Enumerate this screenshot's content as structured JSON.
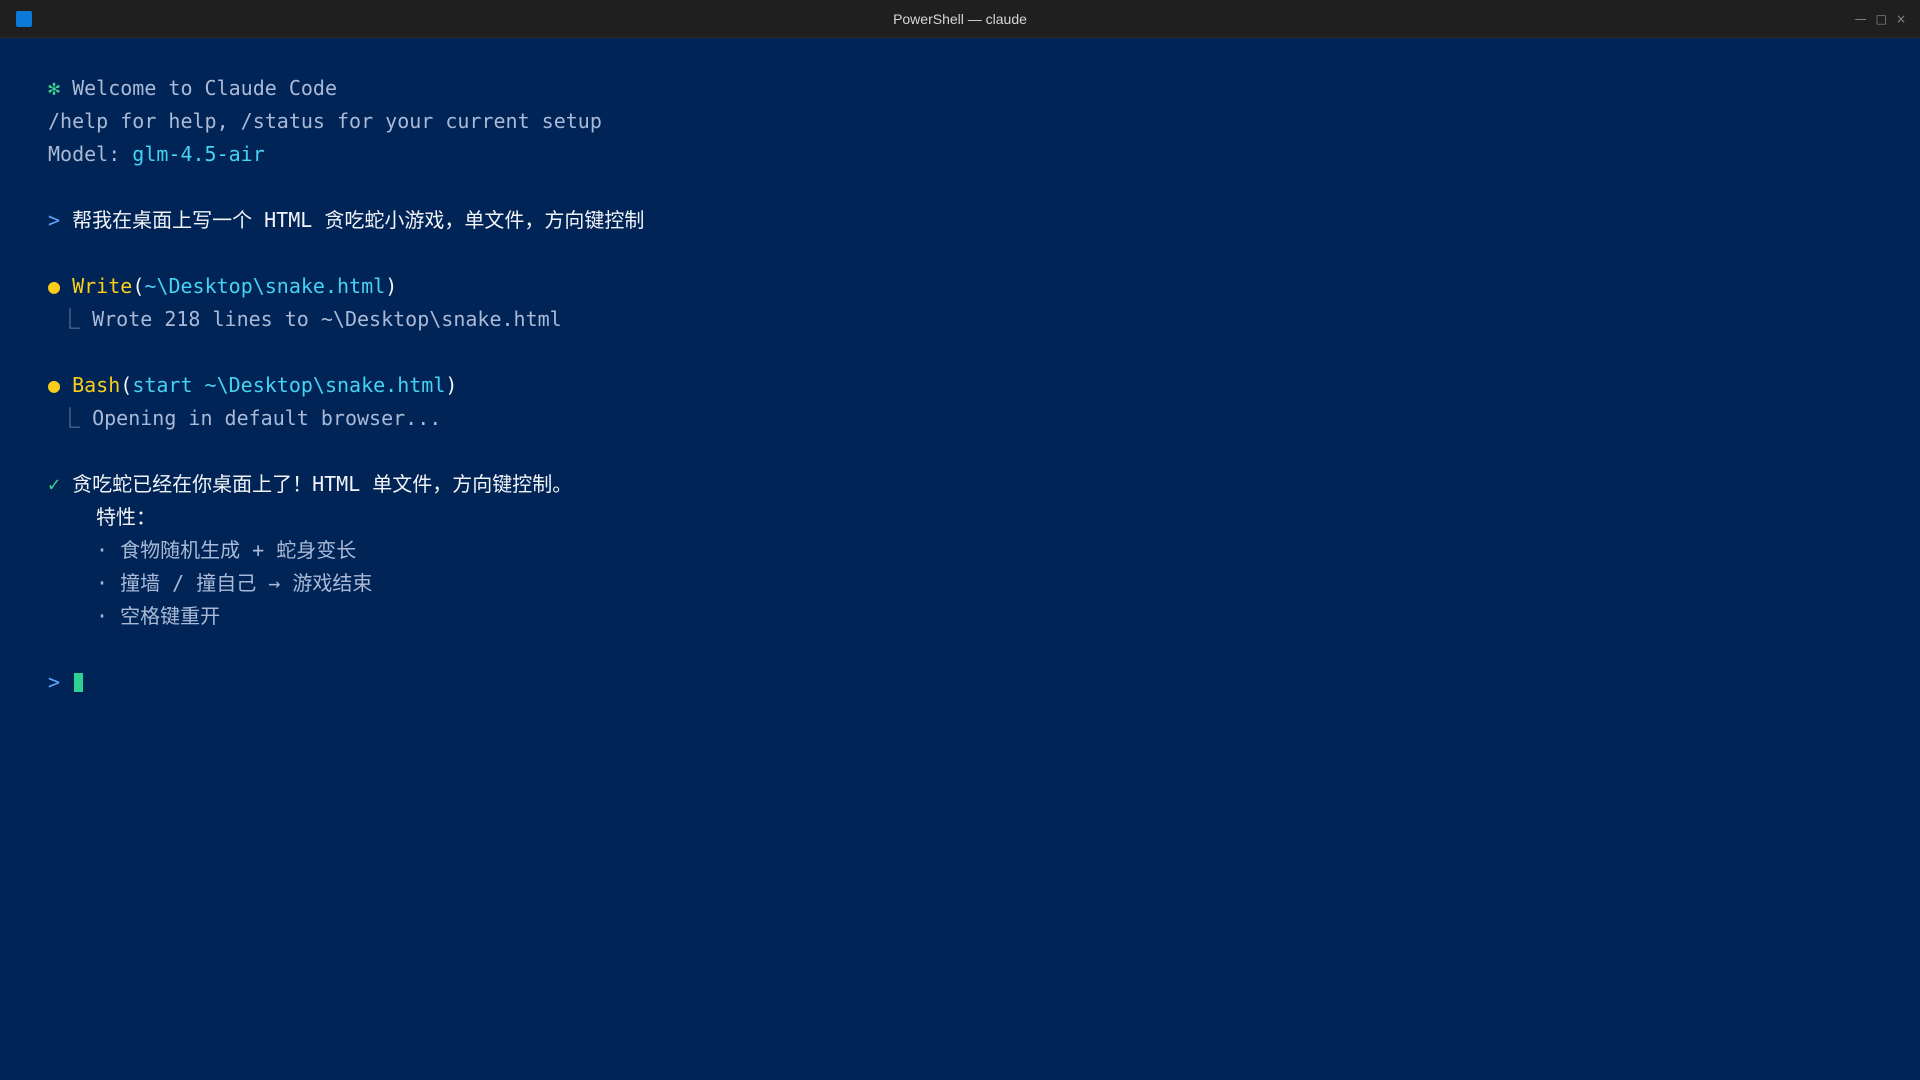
{
  "window": {
    "title": "PowerShell — claude",
    "controls": {
      "minimize": "—",
      "maximize": "□",
      "close": "×"
    },
    "icon": "powershell-app-icon"
  },
  "terminal": {
    "welcome": {
      "star": "✻",
      "text": "Welcome to Claude Code"
    },
    "help_line": "/help for help, /status for your current setup",
    "model": {
      "label": "Model: ",
      "value": "glm-4.5-air"
    },
    "user_prompt": {
      "marker": ">",
      "text": "帮我在桌面上写一个 HTML 贪吃蛇小游戏，单文件，方向键控制"
    },
    "write_tool": {
      "bullet": "●",
      "name": "Write",
      "open_paren": "(",
      "arg": "~\\Desktop\\snake.html",
      "close_paren": ")",
      "branch": "⎿",
      "result": "Wrote 218 lines to ~\\Desktop\\snake.html"
    },
    "bash_tool": {
      "bullet": "●",
      "name": "Bash",
      "open_paren": "(",
      "arg": "start ~\\Desktop\\snake.html",
      "close_paren": ")",
      "branch": "⎿",
      "result": "Opening in default browser..."
    },
    "done": {
      "check": "✓",
      "text": "贪吃蛇已经在你桌面上了！HTML 单文件，方向键控制。",
      "features_label": "特性：",
      "features": [
        {
          "dot": "·",
          "text": "食物随机生成 + 蛇身变长"
        },
        {
          "dot": "·",
          "text": "撞墙 / 撞自己 → 游戏结束"
        },
        {
          "dot": "·",
          "text": "空格键重开"
        }
      ]
    },
    "input_prompt": ">"
  },
  "colors": {
    "background": "#012456",
    "titlebar": "#1f1f1f",
    "accent_cyan": "#45d2f3",
    "accent_yellow": "#f9cf1b",
    "accent_green": "#3fd28b",
    "prompt_blue": "#5ea5ff",
    "cursor": "#2fd094"
  }
}
